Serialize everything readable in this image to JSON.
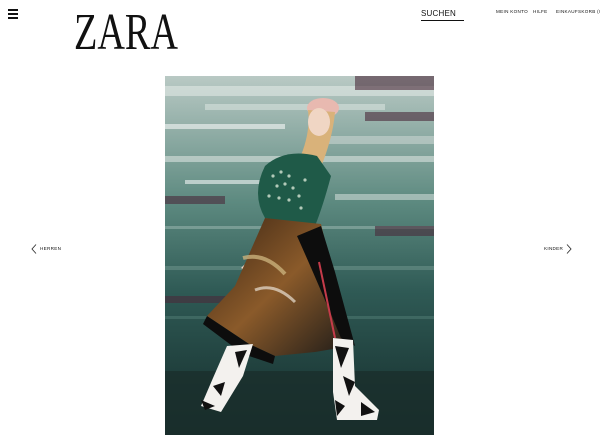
{
  "header": {
    "brand": "ZARA",
    "search_label": "SUCHEN",
    "nav": {
      "account": "MEIN KONTO",
      "help": "HILFE",
      "cart": "EINKAUFSKORB (0)"
    }
  },
  "icons": {
    "menu": "hamburger-menu-icon",
    "prev": "chevron-left-icon",
    "next": "chevron-right-icon"
  },
  "carousel": {
    "prev_label": "HERREN",
    "next_label": "KINDER"
  },
  "colors": {
    "text": "#111111",
    "background": "#ffffff"
  }
}
